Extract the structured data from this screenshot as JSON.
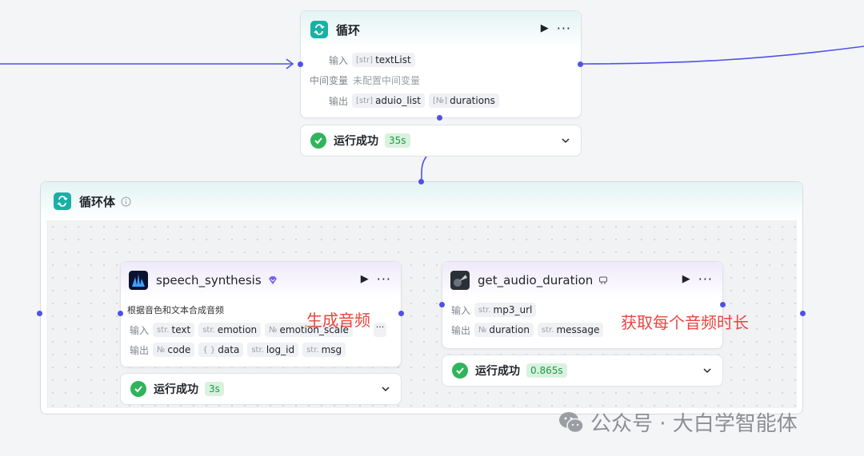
{
  "loop_node": {
    "title": "循环",
    "input_label": "输入",
    "input_var": "textList",
    "input_type": "[str]",
    "mid_label": "中间变量",
    "mid_value": "未配置中间变量",
    "output_label": "输出",
    "outputs": [
      {
        "type": "[str]",
        "name": "aduio_list"
      },
      {
        "type": "[№]",
        "name": "durations"
      }
    ],
    "status": "运行成功",
    "time": "35s"
  },
  "loop_body": {
    "title": "循环体"
  },
  "speech_node": {
    "title": "speech_synthesis",
    "description": "根据音色和文本合成音频",
    "input_label": "输入",
    "inputs": [
      {
        "type": "str.",
        "name": "text"
      },
      {
        "type": "str.",
        "name": "emotion"
      },
      {
        "type": "№",
        "name": "emotion_scale"
      }
    ],
    "output_label": "输出",
    "outputs": [
      {
        "type": "№",
        "name": "code"
      },
      {
        "type": "{ }",
        "name": "data"
      },
      {
        "type": "str.",
        "name": "log_id"
      },
      {
        "type": "str.",
        "name": "msg"
      }
    ],
    "status": "运行成功",
    "time": "3s",
    "annotation": "生成音频"
  },
  "duration_node": {
    "title": "get_audio_duration",
    "input_label": "输入",
    "inputs": [
      {
        "type": "str.",
        "name": "mp3_url"
      }
    ],
    "output_label": "输出",
    "outputs": [
      {
        "type": "№",
        "name": "duration"
      },
      {
        "type": "str.",
        "name": "message"
      }
    ],
    "status": "运行成功",
    "time": "0.865s",
    "annotation": "获取每个音频时长"
  },
  "watermark": "公众号 · 大白学智能体",
  "colors": {
    "edge": "#4e52e6",
    "success": "#2fb45c",
    "loop_icon": "#1ab0a5",
    "annotation": "#e8463d"
  }
}
